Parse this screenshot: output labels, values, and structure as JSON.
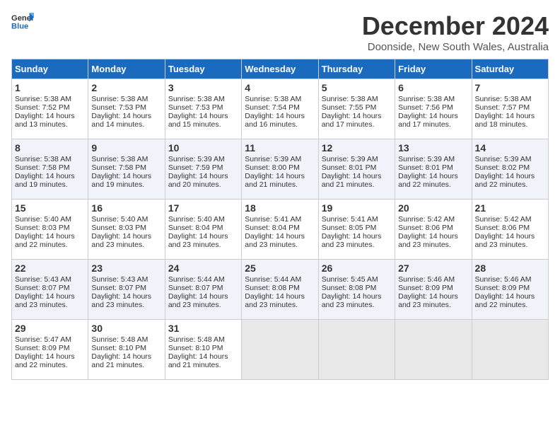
{
  "header": {
    "logo_general": "General",
    "logo_blue": "Blue",
    "month_title": "December 2024",
    "location": "Doonside, New South Wales, Australia"
  },
  "days_of_week": [
    "Sunday",
    "Monday",
    "Tuesday",
    "Wednesday",
    "Thursday",
    "Friday",
    "Saturday"
  ],
  "weeks": [
    [
      {
        "day": 1,
        "lines": [
          "Sunrise: 5:38 AM",
          "Sunset: 7:52 PM",
          "Daylight: 14 hours",
          "and 13 minutes."
        ]
      },
      {
        "day": 2,
        "lines": [
          "Sunrise: 5:38 AM",
          "Sunset: 7:53 PM",
          "Daylight: 14 hours",
          "and 14 minutes."
        ]
      },
      {
        "day": 3,
        "lines": [
          "Sunrise: 5:38 AM",
          "Sunset: 7:53 PM",
          "Daylight: 14 hours",
          "and 15 minutes."
        ]
      },
      {
        "day": 4,
        "lines": [
          "Sunrise: 5:38 AM",
          "Sunset: 7:54 PM",
          "Daylight: 14 hours",
          "and 16 minutes."
        ]
      },
      {
        "day": 5,
        "lines": [
          "Sunrise: 5:38 AM",
          "Sunset: 7:55 PM",
          "Daylight: 14 hours",
          "and 17 minutes."
        ]
      },
      {
        "day": 6,
        "lines": [
          "Sunrise: 5:38 AM",
          "Sunset: 7:56 PM",
          "Daylight: 14 hours",
          "and 17 minutes."
        ]
      },
      {
        "day": 7,
        "lines": [
          "Sunrise: 5:38 AM",
          "Sunset: 7:57 PM",
          "Daylight: 14 hours",
          "and 18 minutes."
        ]
      }
    ],
    [
      {
        "day": 8,
        "lines": [
          "Sunrise: 5:38 AM",
          "Sunset: 7:58 PM",
          "Daylight: 14 hours",
          "and 19 minutes."
        ]
      },
      {
        "day": 9,
        "lines": [
          "Sunrise: 5:38 AM",
          "Sunset: 7:58 PM",
          "Daylight: 14 hours",
          "and 19 minutes."
        ]
      },
      {
        "day": 10,
        "lines": [
          "Sunrise: 5:39 AM",
          "Sunset: 7:59 PM",
          "Daylight: 14 hours",
          "and 20 minutes."
        ]
      },
      {
        "day": 11,
        "lines": [
          "Sunrise: 5:39 AM",
          "Sunset: 8:00 PM",
          "Daylight: 14 hours",
          "and 21 minutes."
        ]
      },
      {
        "day": 12,
        "lines": [
          "Sunrise: 5:39 AM",
          "Sunset: 8:01 PM",
          "Daylight: 14 hours",
          "and 21 minutes."
        ]
      },
      {
        "day": 13,
        "lines": [
          "Sunrise: 5:39 AM",
          "Sunset: 8:01 PM",
          "Daylight: 14 hours",
          "and 22 minutes."
        ]
      },
      {
        "day": 14,
        "lines": [
          "Sunrise: 5:39 AM",
          "Sunset: 8:02 PM",
          "Daylight: 14 hours",
          "and 22 minutes."
        ]
      }
    ],
    [
      {
        "day": 15,
        "lines": [
          "Sunrise: 5:40 AM",
          "Sunset: 8:03 PM",
          "Daylight: 14 hours",
          "and 22 minutes."
        ]
      },
      {
        "day": 16,
        "lines": [
          "Sunrise: 5:40 AM",
          "Sunset: 8:03 PM",
          "Daylight: 14 hours",
          "and 23 minutes."
        ]
      },
      {
        "day": 17,
        "lines": [
          "Sunrise: 5:40 AM",
          "Sunset: 8:04 PM",
          "Daylight: 14 hours",
          "and 23 minutes."
        ]
      },
      {
        "day": 18,
        "lines": [
          "Sunrise: 5:41 AM",
          "Sunset: 8:04 PM",
          "Daylight: 14 hours",
          "and 23 minutes."
        ]
      },
      {
        "day": 19,
        "lines": [
          "Sunrise: 5:41 AM",
          "Sunset: 8:05 PM",
          "Daylight: 14 hours",
          "and 23 minutes."
        ]
      },
      {
        "day": 20,
        "lines": [
          "Sunrise: 5:42 AM",
          "Sunset: 8:06 PM",
          "Daylight: 14 hours",
          "and 23 minutes."
        ]
      },
      {
        "day": 21,
        "lines": [
          "Sunrise: 5:42 AM",
          "Sunset: 8:06 PM",
          "Daylight: 14 hours",
          "and 23 minutes."
        ]
      }
    ],
    [
      {
        "day": 22,
        "lines": [
          "Sunrise: 5:43 AM",
          "Sunset: 8:07 PM",
          "Daylight: 14 hours",
          "and 23 minutes."
        ]
      },
      {
        "day": 23,
        "lines": [
          "Sunrise: 5:43 AM",
          "Sunset: 8:07 PM",
          "Daylight: 14 hours",
          "and 23 minutes."
        ]
      },
      {
        "day": 24,
        "lines": [
          "Sunrise: 5:44 AM",
          "Sunset: 8:07 PM",
          "Daylight: 14 hours",
          "and 23 minutes."
        ]
      },
      {
        "day": 25,
        "lines": [
          "Sunrise: 5:44 AM",
          "Sunset: 8:08 PM",
          "Daylight: 14 hours",
          "and 23 minutes."
        ]
      },
      {
        "day": 26,
        "lines": [
          "Sunrise: 5:45 AM",
          "Sunset: 8:08 PM",
          "Daylight: 14 hours",
          "and 23 minutes."
        ]
      },
      {
        "day": 27,
        "lines": [
          "Sunrise: 5:46 AM",
          "Sunset: 8:09 PM",
          "Daylight: 14 hours",
          "and 23 minutes."
        ]
      },
      {
        "day": 28,
        "lines": [
          "Sunrise: 5:46 AM",
          "Sunset: 8:09 PM",
          "Daylight: 14 hours",
          "and 22 minutes."
        ]
      }
    ],
    [
      {
        "day": 29,
        "lines": [
          "Sunrise: 5:47 AM",
          "Sunset: 8:09 PM",
          "Daylight: 14 hours",
          "and 22 minutes."
        ]
      },
      {
        "day": 30,
        "lines": [
          "Sunrise: 5:48 AM",
          "Sunset: 8:10 PM",
          "Daylight: 14 hours",
          "and 21 minutes."
        ]
      },
      {
        "day": 31,
        "lines": [
          "Sunrise: 5:48 AM",
          "Sunset: 8:10 PM",
          "Daylight: 14 hours",
          "and 21 minutes."
        ]
      },
      null,
      null,
      null,
      null
    ]
  ]
}
